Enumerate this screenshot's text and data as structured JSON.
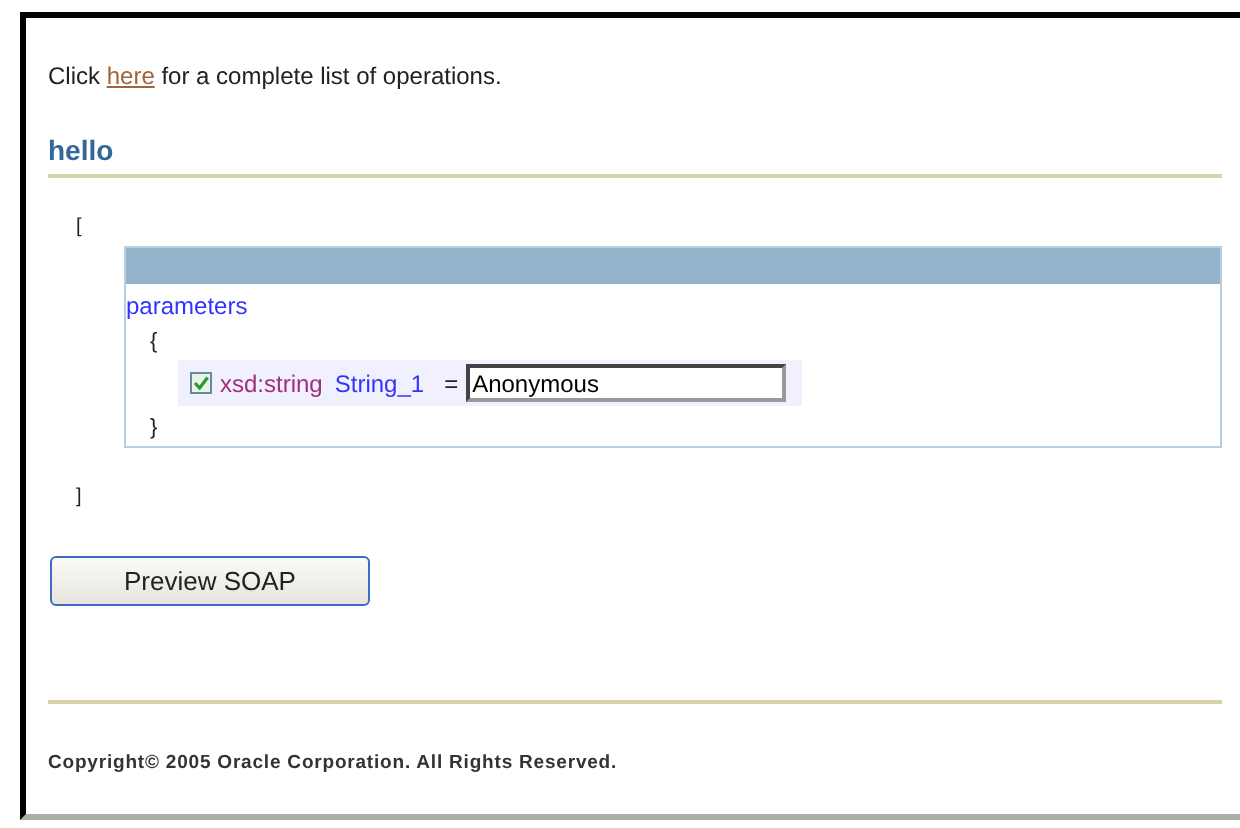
{
  "intro": {
    "before": "Click ",
    "link": "here",
    "after": " for a complete list of operations."
  },
  "operation": {
    "title": "hello",
    "open_bracket": "[",
    "close_bracket": "]",
    "group": {
      "label": "parameters",
      "open_brace": "{",
      "close_brace": "}",
      "fields": [
        {
          "checked": true,
          "type": "xsd:string",
          "name": "String_1",
          "equals": "=",
          "value": "Anonymous"
        }
      ]
    }
  },
  "buttons": [
    "Preview SOAP"
  ],
  "footer": "Copyright© 2005 Oracle Corporation. All Rights Reserved."
}
